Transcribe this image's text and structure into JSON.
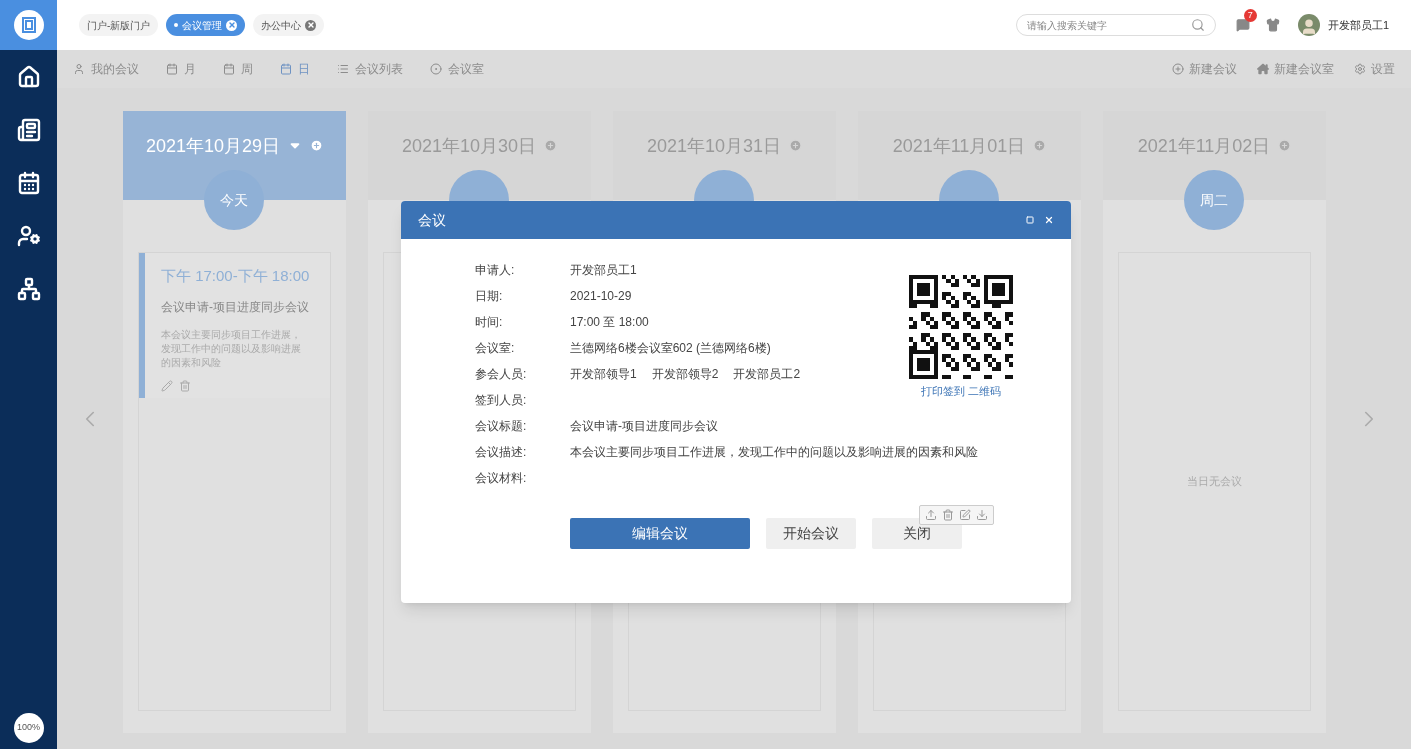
{
  "sidebar": {
    "zoom": "100%"
  },
  "top_tabs": [
    {
      "label": "门户-新版门户",
      "selected": false,
      "closable": false
    },
    {
      "label": "会议管理",
      "selected": true,
      "closable": true
    },
    {
      "label": "办公中心",
      "selected": false,
      "closable": true
    }
  ],
  "search": {
    "placeholder": "请输入搜索关键字"
  },
  "notifications": {
    "count": "7"
  },
  "user": {
    "name": "开发部员工1"
  },
  "toolbar": {
    "left": [
      {
        "label": "我的会议",
        "selected": false
      },
      {
        "label": "月",
        "selected": false
      },
      {
        "label": "周",
        "selected": false
      },
      {
        "label": "日",
        "selected": true
      },
      {
        "label": "会议列表",
        "selected": false
      },
      {
        "label": "会议室",
        "selected": false
      }
    ],
    "right": [
      {
        "label": "新建会议"
      },
      {
        "label": "新建会议室"
      },
      {
        "label": "设置"
      }
    ]
  },
  "days": [
    {
      "date": "2021年10月29日",
      "badge": "今天",
      "today": true,
      "meetings": [
        {
          "time": "下午 17:00-下午 18:00",
          "title": "会议申请-项目进度同步会议",
          "description": "本会议主要同步项目工作进展，发现工作中的问题以及影响进展的因素和风险"
        }
      ]
    },
    {
      "date": "2021年10月30日",
      "today": false
    },
    {
      "date": "2021年10月31日",
      "today": false
    },
    {
      "date": "2021年11月01日",
      "today": false
    },
    {
      "date": "2021年11月02日",
      "badge": "周二",
      "today": false,
      "empty_text": "当日无会议"
    }
  ],
  "modal": {
    "title": "会议",
    "fields": [
      {
        "label": "申请人:",
        "values": [
          "开发部员工1"
        ]
      },
      {
        "label": "日期:",
        "values": [
          "2021-10-29"
        ]
      },
      {
        "label": "时间:",
        "values": [
          "17:00 至 18:00"
        ]
      },
      {
        "label": "会议室:",
        "values": [
          "兰德网络6楼会议室602 (兰德网络6楼)"
        ]
      },
      {
        "label": "参会人员:",
        "values": [
          "开发部领导1",
          "开发部领导2",
          "开发部员工2"
        ]
      },
      {
        "label": "签到人员:"
      },
      {
        "label": "会议标题:",
        "values": [
          "会议申请-项目进度同步会议"
        ]
      },
      {
        "label": "会议描述:",
        "values": [
          "本会议主要同步项目工作进展，发现工作中的问题以及影响进展的因素和风险"
        ]
      },
      {
        "label": "会议材料:",
        "kind": "files"
      }
    ],
    "qr_link": "打印签到 二维码",
    "buttons": [
      {
        "label": "编辑会议",
        "kind": "primary"
      },
      {
        "label": "开始会议",
        "kind": "secondary"
      },
      {
        "label": "关闭",
        "kind": "secondary"
      }
    ]
  }
}
